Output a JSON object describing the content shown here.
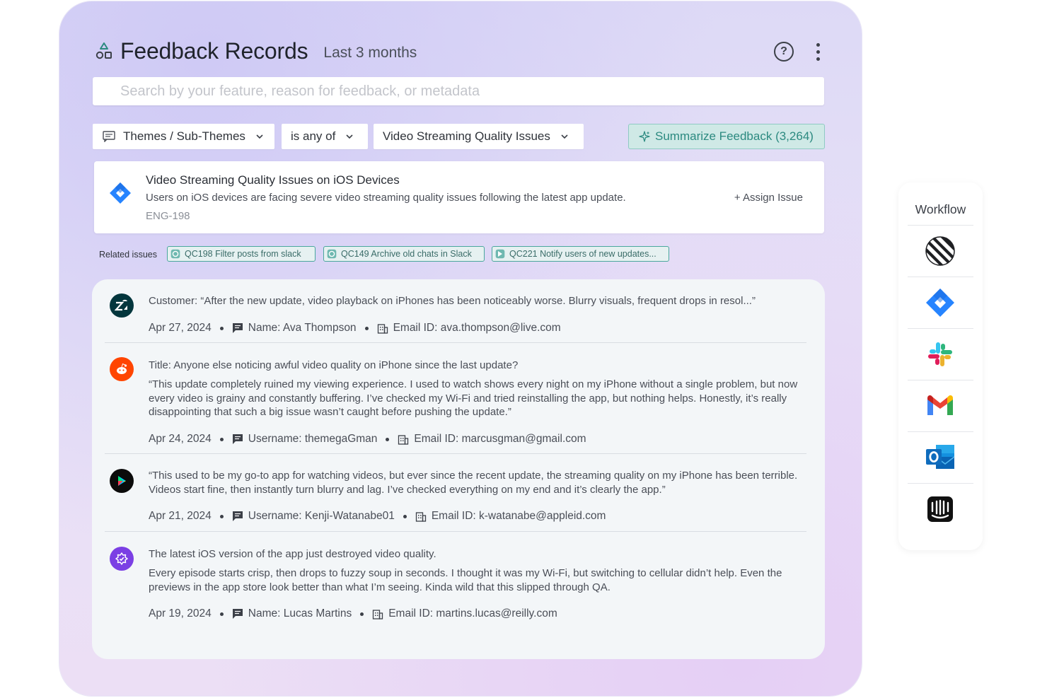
{
  "header": {
    "title": "Feedback Records",
    "subtitle": "Last 3 months",
    "logo_icon": "shapes-icon",
    "help_icon": "help-circle-icon",
    "more_icon": "more-vertical-icon"
  },
  "search": {
    "placeholder": "Search by your feature, reason for feedback, or metadata",
    "value": ""
  },
  "filters": {
    "field": "Themes / Sub-Themes",
    "operator": "is any of",
    "value": "Video Streaming Quality Issues"
  },
  "summarize_button": {
    "label": "Summarize Feedback (3,264)",
    "color": "#2c8a80"
  },
  "issue": {
    "title": "Video Streaming Quality Issues on iOS Devices",
    "description": "Users on iOS devices are facing severe video streaming quality issues following the latest app update.",
    "id": "ENG-198",
    "assign_label": "+ Assign Issue",
    "icon": "jira-icon"
  },
  "related": {
    "label": "Related issues",
    "chips": [
      "QC198 Filter posts from slack",
      "QC149 Archive old chats in Slack",
      "QC221 Notify users of new updates..."
    ]
  },
  "feedback": [
    {
      "source": "zendesk-icon",
      "quote": "Customer:   “After the new update, video playback on iPhones has been noticeably worse. Blurry visuals, frequent drops in resol...”",
      "date": "Apr 27, 2024",
      "name": "Name: Ava Thompson",
      "email": "Email ID: ava.thompson@live.com"
    },
    {
      "source": "reddit-icon",
      "title": "Title: Anyone else noticing awful video quality on iPhone since the last update?",
      "body": "“This update completely ruined my viewing experience. I used to watch shows every night on my iPhone without a single problem, but now every video is grainy and constantly buffering. I’ve checked my Wi-Fi and tried reinstalling the app, but nothing helps. Honestly, it’s really disappointing that such a big issue wasn’t caught before pushing the update.”",
      "date": "Apr 24, 2024",
      "name": "Username: themegaGman",
      "email": "Email ID: marcusgman@gmail.com"
    },
    {
      "source": "google-play-icon",
      "body": "“This used to be my go-to app for watching videos, but ever since the recent update, the streaming quality on my iPhone has been terrible. Videos start fine, then instantly turn blurry and lag. I’ve checked everything on my end and it’s clearly the app.”",
      "date": "Apr 21, 2024",
      "name": "Username: Kenji-Watanabe01",
      "email": "Email ID: k-watanabe@appleid.com"
    },
    {
      "source": "app-badge-icon",
      "title": "The latest iOS version of the app just destroyed video quality.",
      "body": "Every episode starts crisp, then drops to fuzzy soup in seconds. I thought it was my Wi-Fi, but switching to cellular didn’t help. Even the previews in the app store look better than what I’m seeing. Kinda wild that this slipped through QA.",
      "date": "Apr 19, 2024",
      "name": "Name: Lucas Martins",
      "email": "Email ID: martins.lucas@reilly.com"
    }
  ],
  "workflow": {
    "title": "Workflow",
    "apps": [
      "linear-icon",
      "jira-icon",
      "slack-icon",
      "gmail-icon",
      "outlook-icon",
      "intercom-icon"
    ]
  }
}
